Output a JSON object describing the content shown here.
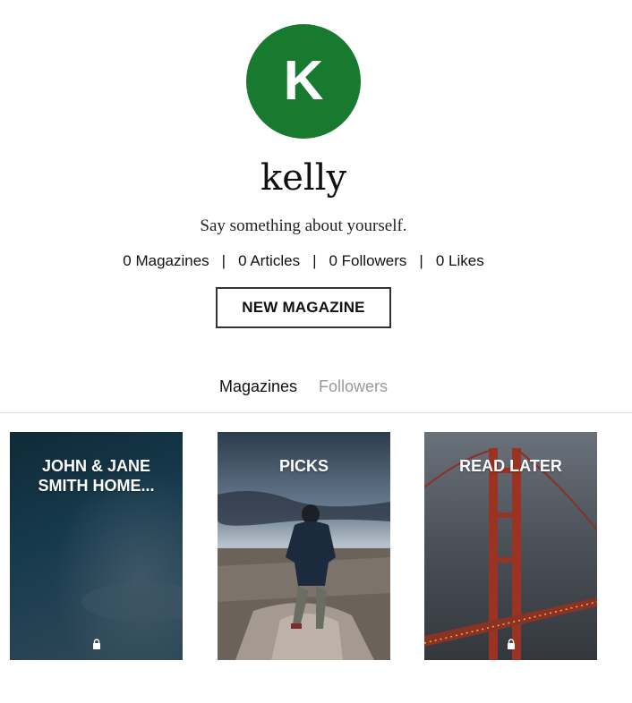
{
  "profile": {
    "avatar_initial": "K",
    "avatar_color": "#187a2f",
    "username": "kelly",
    "bio": "Say something about yourself.",
    "stats": {
      "magazines": "0 Magazines",
      "articles": "0 Articles",
      "followers": "0 Followers",
      "likes": "0 Likes",
      "separator": "|"
    },
    "new_magazine_label": "NEW MAGAZINE"
  },
  "tabs": [
    {
      "label": "Magazines",
      "active": true
    },
    {
      "label": "Followers",
      "active": false
    }
  ],
  "magazines": [
    {
      "title": "JOHN & JANE SMITH HOME...",
      "private": true,
      "icon": "lock-icon"
    },
    {
      "title": "PICKS",
      "private": false
    },
    {
      "title": "READ LATER",
      "private": true,
      "icon": "lock-icon"
    }
  ]
}
